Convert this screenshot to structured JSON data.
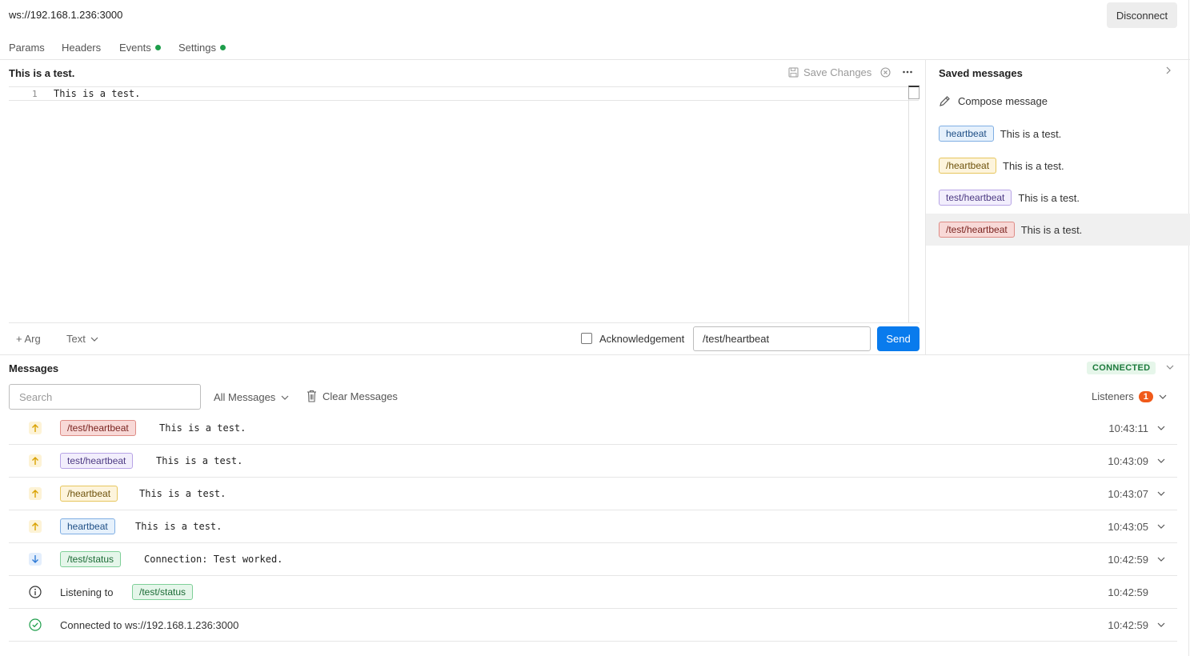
{
  "connection": {
    "url": "ws://192.168.1.236:3000",
    "disconnect_label": "Disconnect",
    "status": "CONNECTED"
  },
  "tabs": [
    {
      "label": "Params",
      "dot": false
    },
    {
      "label": "Headers",
      "dot": false
    },
    {
      "label": "Events",
      "dot": true
    },
    {
      "label": "Settings",
      "dot": true
    }
  ],
  "editor": {
    "title": "This is a test.",
    "save_label": "Save Changes",
    "line_number": "1",
    "content": "This is a test.",
    "arg_label": "+ Arg",
    "format_label": "Text",
    "ack_label": "Acknowledgement",
    "event_value": "/test/heartbeat",
    "send_label": "Send"
  },
  "saved": {
    "title": "Saved messages",
    "compose_label": "Compose message",
    "items": [
      {
        "event": "heartbeat",
        "text": "This is a test.",
        "color": "blue"
      },
      {
        "event": "/heartbeat",
        "text": "This is a test.",
        "color": "yellow"
      },
      {
        "event": "test/heartbeat",
        "text": "This is a test.",
        "color": "purple"
      },
      {
        "event": "/test/heartbeat",
        "text": "This is a test.",
        "color": "red"
      }
    ]
  },
  "messages": {
    "title": "Messages",
    "search_placeholder": "Search",
    "filter_label": "All Messages",
    "clear_label": "Clear Messages",
    "listeners_label": "Listeners",
    "listeners_count": "1",
    "rows": [
      {
        "kind": "sent",
        "event": "/test/heartbeat",
        "color": "red",
        "text": "This is a test.",
        "time": "10:43:11"
      },
      {
        "kind": "sent",
        "event": "test/heartbeat",
        "color": "purple",
        "text": "This is a test.",
        "time": "10:43:09"
      },
      {
        "kind": "sent",
        "event": "/heartbeat",
        "color": "yellow",
        "text": "This is a test.",
        "time": "10:43:07"
      },
      {
        "kind": "sent",
        "event": "heartbeat",
        "color": "blue",
        "text": "This is a test.",
        "time": "10:43:05"
      },
      {
        "kind": "received",
        "event": "/test/status",
        "color": "green",
        "text": "Connection: Test worked.",
        "time": "10:42:59"
      },
      {
        "kind": "info",
        "prefix": "Listening to",
        "event": "/test/status",
        "color": "green",
        "time": "10:42:59"
      },
      {
        "kind": "connected",
        "text": "Connected to ws://192.168.1.236:3000",
        "time": "10:42:59"
      }
    ]
  },
  "colors": {
    "send_button": "#097bed",
    "status_green": "#1c7a3c",
    "badge_orange": "#f05a1a",
    "sent_arrow": "#e0a400",
    "received_arrow": "#2f7bd6"
  }
}
